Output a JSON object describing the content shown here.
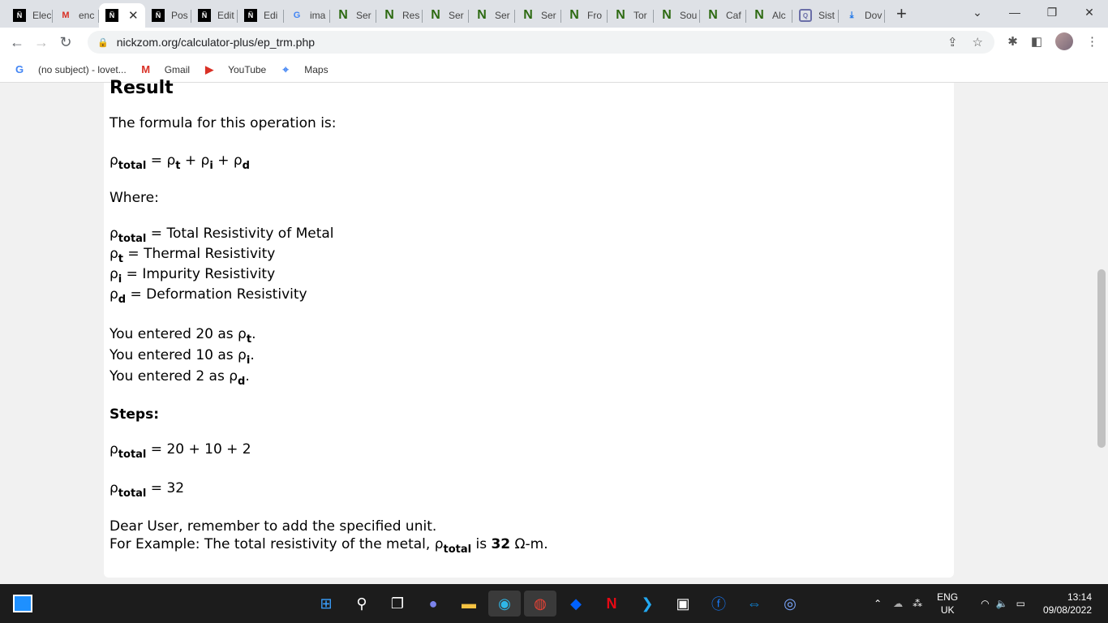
{
  "browser": {
    "tabs": [
      {
        "label": "Elec",
        "icon": "nickzom-icon"
      },
      {
        "label": "enc",
        "icon": "gmail-icon"
      },
      {
        "label": "",
        "icon": "nickzom-icon",
        "active": true
      },
      {
        "label": "Pos",
        "icon": "nickzom-icon"
      },
      {
        "label": "Edit",
        "icon": "nickzom-icon"
      },
      {
        "label": "Edi",
        "icon": "nickzom-icon"
      },
      {
        "label": "ima",
        "icon": "google-icon"
      },
      {
        "label": "Ser",
        "icon": "n-icon"
      },
      {
        "label": "Res",
        "icon": "n-icon"
      },
      {
        "label": "Ser",
        "icon": "n-icon"
      },
      {
        "label": "Ser",
        "icon": "n-icon"
      },
      {
        "label": "Ser",
        "icon": "n-icon"
      },
      {
        "label": "Fro",
        "icon": "n-icon"
      },
      {
        "label": "Tor",
        "icon": "n-icon"
      },
      {
        "label": "Sou",
        "icon": "n-icon"
      },
      {
        "label": "Caf",
        "icon": "n-icon"
      },
      {
        "label": "Alc",
        "icon": "n-icon"
      },
      {
        "label": "Sist",
        "icon": "sist-icon"
      },
      {
        "label": "Dov",
        "icon": "download-icon"
      }
    ],
    "url": "nickzom.org/calculator-plus/ep_trm.php",
    "bookmarks": [
      {
        "label": "(no subject) - lovet...",
        "icon": "google-icon"
      },
      {
        "label": "Gmail",
        "icon": "gmail-icon"
      },
      {
        "label": "YouTube",
        "icon": "youtube-icon"
      },
      {
        "label": "Maps",
        "icon": "maps-icon"
      }
    ]
  },
  "result": {
    "heading": "Result",
    "formula_intro": "The formula for this operation is:",
    "rho": "ρ",
    "formula": {
      "sub_total": "total",
      "eq": " = ",
      "sub_t": "t",
      "sub_i": "i",
      "sub_d": "d",
      "plus": " + "
    },
    "where": "Where:",
    "defs": [
      {
        "sub": "total",
        "text": " = Total Resistivity of Metal"
      },
      {
        "sub": "t",
        "text": " = Thermal Resistivity"
      },
      {
        "sub": "i",
        "text": " = Impurity Resistivity"
      },
      {
        "sub": "d",
        "text": " = Deformation Resistivity"
      }
    ],
    "entered": [
      {
        "text": "You entered 20 as ",
        "sub": "t"
      },
      {
        "text": "You entered 10 as ",
        "sub": "i"
      },
      {
        "text": "You entered 2 as ",
        "sub": "d"
      }
    ],
    "steps_label": "Steps:",
    "step1": " = 20 + 10 + 2",
    "step2": " = 32",
    "note1": "Dear User, remember to add the specified unit.",
    "note2_a": "For Example: The total resistivity of the metal, ",
    "note2_b": " is ",
    "note2_value": "32",
    "note2_unit": " Ω-m."
  },
  "taskbar": {
    "lang": "ENG",
    "region": "UK",
    "time": "13:14",
    "date": "09/08/2022"
  }
}
